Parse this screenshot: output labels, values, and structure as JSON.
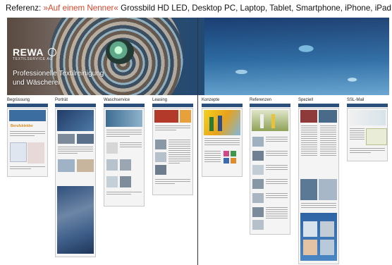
{
  "headline": {
    "prefix": "Referenz: ",
    "accent": "»Auf einem Nenner«",
    "rest": " Grossbild HD LED, Desktop PC, Laptop, Tablet, Smartphone, iPhone, iPad"
  },
  "hero": {
    "logo": "REWA",
    "logo_sub": "TEXTILSERVICE AG",
    "tagline_1": "Professionelle Textilreinigung",
    "tagline_2": "und Wäscherei"
  },
  "columns": [
    {
      "label": "Begrüssung",
      "promo": "Berufskleider"
    },
    {
      "label": "Porträt"
    },
    {
      "label": "Waschservice"
    },
    {
      "label": "Leasing"
    },
    {
      "label": "Konzepte"
    },
    {
      "label": "Referenzen"
    },
    {
      "label": "Speziell"
    },
    {
      "label": "SSL-Mail"
    }
  ],
  "colors": {
    "accent": "#d9452b",
    "nav": "#2a4f7a",
    "hero_blue": "#204a78"
  }
}
